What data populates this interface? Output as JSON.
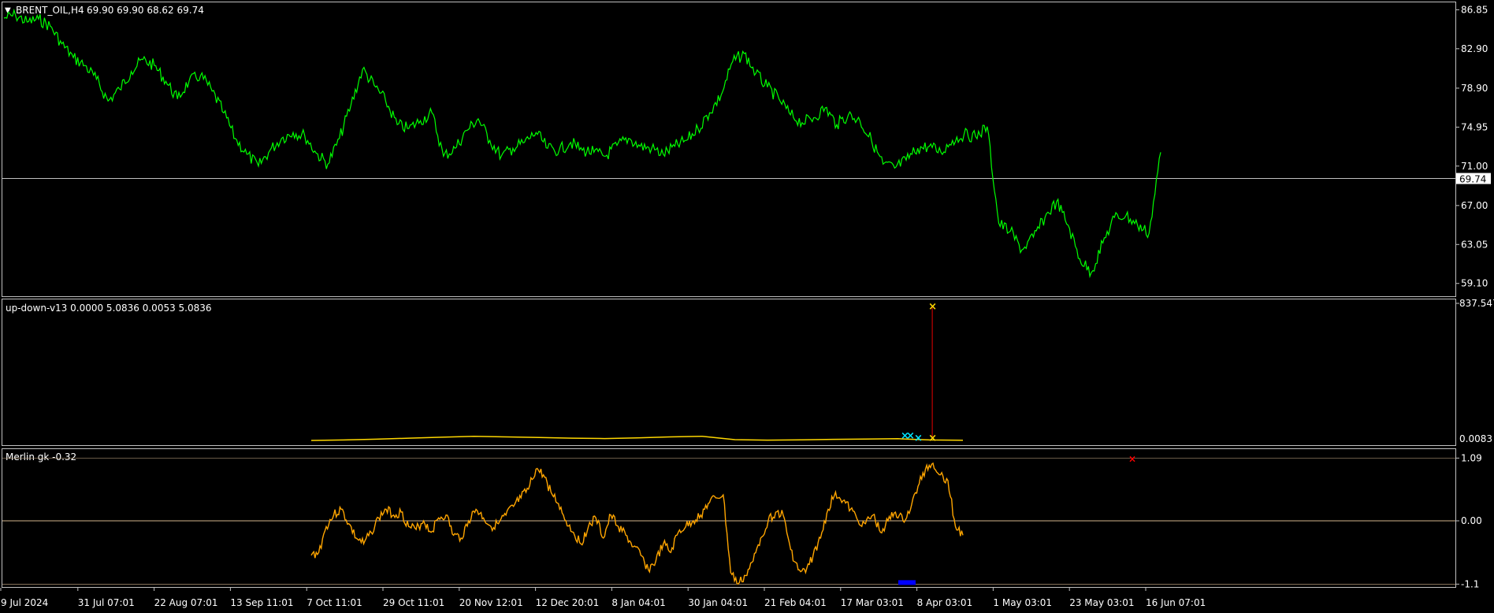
{
  "header": {
    "symbol_label": "BRENT_OIL,H4",
    "ohlc_text": "69.90 69.90 68.62 69.74",
    "current_price_tag": "69.74"
  },
  "panes": {
    "indicator1_label": "up-down-v13 0.0000 5.0836 0.0053 5.0836",
    "indicator1_top_value": "837.547",
    "indicator1_bottom_value": "0.0083",
    "indicator2_label": "Merlin gk -0.32"
  },
  "time_axis": [
    "9 Jul 2024",
    "31 Jul 07:01",
    "22 Aug 07:01",
    "13 Sep 11:01",
    "7 Oct 11:01",
    "29 Oct 11:01",
    "20 Nov 12:01",
    "12 Dec 20:01",
    "8 Jan 04:01",
    "30 Jan 04:01",
    "21 Feb 04:01",
    "17 Mar 03:01",
    "8 Apr 03:01",
    "1 May 03:01",
    "23 May 03:01",
    "16 Jun 07:01"
  ],
  "colors": {
    "price_line": "#00ff00",
    "indicator1_line": "#ffd700",
    "indicator1_spike": "#c00000",
    "indicator1_marker": "#ffd700",
    "indicator1_marker_cyan": "#00e5ff",
    "indicator2_line": "#ffa500",
    "indicator2_marker_low": "#0000ff",
    "indicator2_marker_high": "#ff0000",
    "grid_line": "#c0c0c0",
    "zero_line": "#d2b48c"
  },
  "chart_data": [
    {
      "type": "line",
      "title": "BRENT_OIL,H4",
      "y_ticks": [
        "86.85",
        "82.90",
        "78.90",
        "74.95",
        "71.00",
        "67.00",
        "63.05",
        "59.10"
      ],
      "ylim": [
        57.8,
        87.6
      ],
      "x": [
        0,
        1,
        2,
        3,
        4,
        5,
        6,
        7,
        8,
        9,
        10,
        11,
        12,
        13,
        14,
        15,
        16,
        17,
        18,
        19,
        20,
        21,
        22,
        23,
        24,
        25,
        26,
        27,
        28,
        29,
        30,
        31,
        32,
        33,
        34,
        35,
        36,
        37,
        38,
        39,
        40,
        41,
        42,
        43,
        44,
        45,
        46,
        47,
        48,
        49,
        50,
        51,
        52,
        53,
        54,
        55,
        56,
        57,
        58,
        59,
        60,
        61,
        62,
        63,
        64,
        65,
        66,
        67,
        68,
        69,
        70,
        71,
        72,
        73,
        74,
        75,
        76,
        77,
        78,
        79,
        80,
        81,
        82,
        83,
        84,
        85,
        86,
        87,
        88,
        89,
        90,
        91,
        92,
        93,
        94,
        95,
        96,
        97,
        98,
        99,
        100
      ],
      "series": [
        {
          "values": [
            86.0,
            86.3,
            85.6,
            85.9,
            85.2,
            83.4,
            82.0,
            81.2,
            79.8,
            77.6,
            78.8,
            80.6,
            81.8,
            81.2,
            79.6,
            77.8,
            79.6,
            80.2,
            78.6,
            76.4,
            73.8,
            72.2,
            71.0,
            72.6,
            73.8,
            74.4,
            74.1,
            72.3,
            71.2,
            73.8,
            77.2,
            80.8,
            79.2,
            77.6,
            75.2,
            74.8,
            75.6,
            76.4,
            72.0,
            72.8,
            74.6,
            75.8,
            73.6,
            72.0,
            72.8,
            73.4,
            74.4,
            72.8,
            72.6,
            73.4,
            72.6,
            72.4,
            72.0,
            73.1,
            73.8,
            73.0,
            72.8,
            72.2,
            73.0,
            73.6,
            74.8,
            76.4,
            78.2,
            81.6,
            82.4,
            80.4,
            79.0,
            77.8,
            76.2,
            75.4,
            75.9,
            76.9,
            75.2,
            76.2,
            75.6,
            73.6,
            71.2,
            70.8,
            71.6,
            72.8,
            73.0,
            72.4,
            73.6,
            74.2,
            74.0,
            75.0,
            65.2,
            64.4,
            62.5,
            63.8,
            65.8,
            67.4,
            65.0,
            61.6,
            60.2,
            63.2,
            65.8,
            66.0,
            65.0,
            64.2,
            72.4
          ]
        }
      ]
    },
    {
      "type": "line",
      "title": "up-down-v13",
      "ylim": [
        0.0083,
        837.547
      ],
      "x": [
        0,
        5,
        10,
        15,
        20,
        25,
        30,
        35,
        40,
        45,
        50,
        55,
        60,
        65,
        70,
        75,
        80,
        85,
        90,
        95,
        100
      ],
      "series": [
        {
          "values": [
            0,
            3,
            8,
            14,
            20,
            26,
            22,
            18,
            14,
            12,
            16,
            22,
            26,
            5,
            2,
            4,
            7,
            9,
            11,
            3,
            1
          ]
        }
      ],
      "spike": {
        "at_x": 95.3,
        "value": 837.547
      }
    },
    {
      "type": "line",
      "title": "Merlin gk -0.32",
      "y_ticks": [
        "1.09",
        "0.00",
        "-1.1"
      ],
      "ylim": [
        -1.15,
        1.15
      ],
      "x": [
        0,
        1,
        2,
        3,
        4,
        5,
        6,
        7,
        8,
        9,
        10,
        11,
        12,
        13,
        14,
        15,
        16,
        17,
        18,
        19,
        20,
        21,
        22,
        23,
        24,
        25,
        26,
        27,
        28,
        29,
        30,
        31,
        32,
        33,
        34,
        35,
        36,
        37,
        38,
        39,
        40,
        41,
        42,
        43,
        44,
        45,
        46,
        47,
        48,
        49,
        50,
        51,
        52,
        53,
        54,
        55,
        56,
        57,
        58,
        59,
        60,
        61,
        62,
        63,
        64,
        65,
        66,
        67,
        68,
        69,
        70,
        71,
        72,
        73,
        74,
        75,
        76,
        77,
        78,
        79,
        80,
        81,
        82,
        83,
        84,
        85,
        86,
        87,
        88,
        89,
        90,
        91,
        92,
        93,
        94,
        95,
        96,
        97,
        98,
        99,
        100
      ],
      "series": [
        {
          "values": [
            -0.6,
            -0.55,
            -0.1,
            0.1,
            0.2,
            -0.05,
            -0.3,
            -0.4,
            -0.2,
            0.05,
            0.2,
            0.1,
            0.15,
            -0.1,
            -0.15,
            0.0,
            -0.2,
            0.05,
            0.1,
            -0.25,
            -0.3,
            0.0,
            0.2,
            0.05,
            -0.1,
            -0.05,
            0.1,
            0.25,
            0.4,
            0.55,
            0.9,
            0.8,
            0.5,
            0.3,
            0.0,
            -0.2,
            -0.4,
            -0.1,
            0.05,
            -0.3,
            0.1,
            -0.1,
            -0.25,
            -0.45,
            -0.6,
            -0.85,
            -0.7,
            -0.4,
            -0.55,
            -0.2,
            -0.1,
            0.0,
            0.1,
            0.3,
            0.4,
            0.45,
            -0.9,
            -1.1,
            -0.95,
            -0.7,
            -0.3,
            0.0,
            0.15,
            0.1,
            -0.5,
            -0.85,
            -0.9,
            -0.6,
            -0.3,
            0.2,
            0.5,
            0.35,
            0.2,
            0.0,
            -0.05,
            0.1,
            -0.2,
            0.0,
            0.15,
            0.0,
            0.2,
            0.6,
            0.9,
            1.0,
            0.8,
            0.7,
            -0.1,
            -0.25
          ]
        }
      ]
    }
  ]
}
